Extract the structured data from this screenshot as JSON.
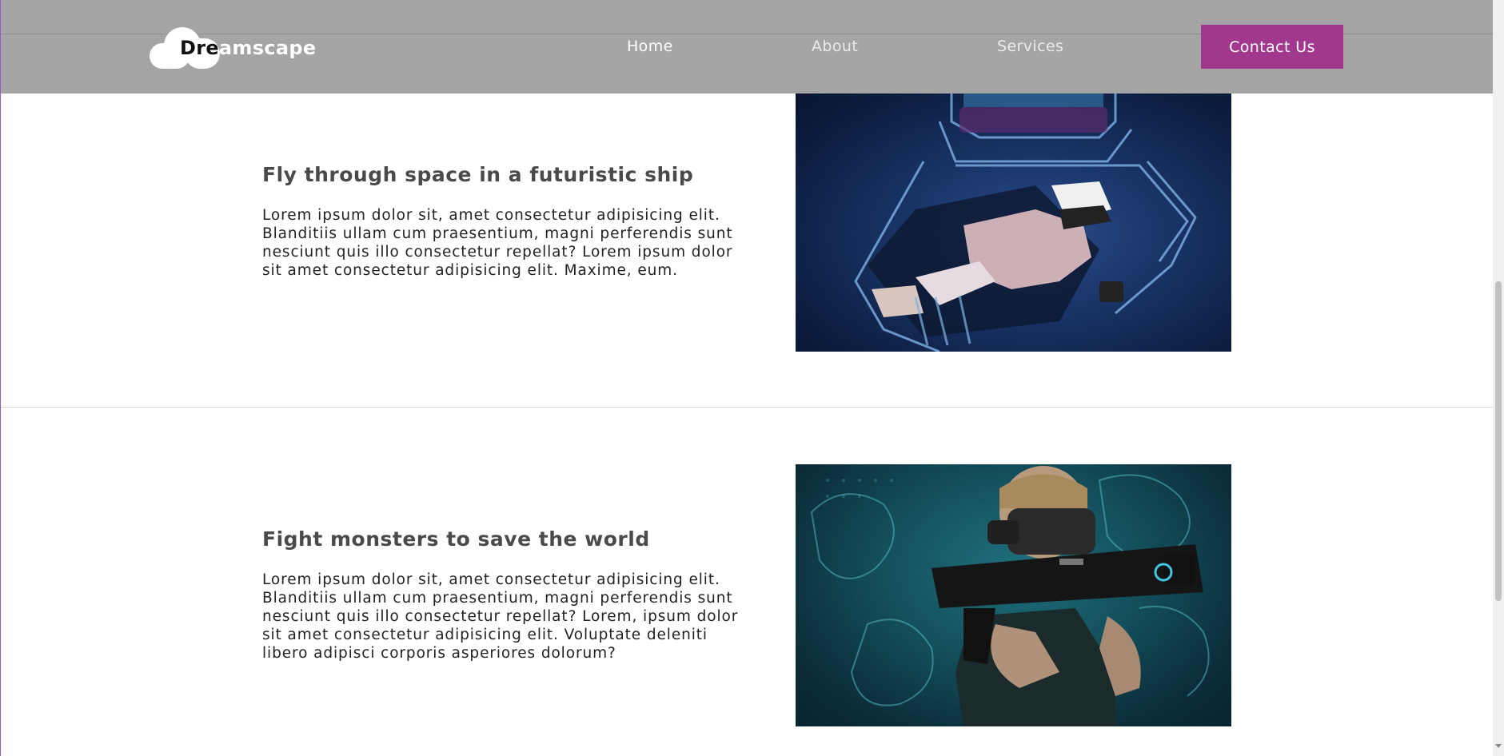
{
  "header": {
    "logo_text": "Dreamscape",
    "nav": {
      "home": "Home",
      "about": "About",
      "services": "Services"
    },
    "contact_label": "Contact Us"
  },
  "sections": [
    {
      "title": "Fly through space in a futuristic ship",
      "body": "Lorem ipsum dolor sit, amet consectetur adipisicing elit. Blanditiis ullam cum praesentium, magni perferendis sunt nesciunt quis illo consectetur repellat? Lorem ipsum dolor sit amet consectetur adipisicing elit. Maxime, eum."
    },
    {
      "title": "Fight monsters to save the world",
      "body": "Lorem ipsum dolor sit, amet consectetur adipisicing elit. Blanditiis ullam cum praesentium, magni perferendis sunt nesciunt quis illo consectetur repellat? Lorem, ipsum dolor sit amet consectetur adipisicing elit. Voluptate deleniti libero adipisci corporis asperiores dolorum?"
    }
  ],
  "colors": {
    "header_bg": "#a5a5a5",
    "accent": "#a2378e",
    "title": "#4a4a4a",
    "body_text": "#222222"
  }
}
